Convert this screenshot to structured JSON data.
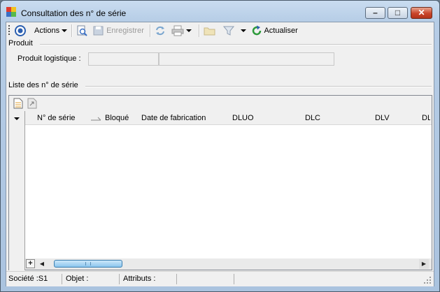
{
  "window": {
    "title": "Consultation des n° de série",
    "controls": {
      "minimize": "–",
      "maximize": "□",
      "close": "✕"
    }
  },
  "toolbar": {
    "actions_label": "Actions",
    "save_label": "Enregistrer",
    "refresh_label": "Actualiser"
  },
  "produit": {
    "section_title": "Produit",
    "label": "Produit logistique :",
    "code_value": "",
    "name_value": ""
  },
  "liste": {
    "section_title": "Liste des n° de série",
    "columns": [
      "N° de série",
      "Bloqué",
      "Date de fabrication",
      "DLUO",
      "DLC",
      "DLV",
      "DL"
    ],
    "rows": []
  },
  "statusbar": {
    "societe": "Société :S1",
    "objet": "Objet :",
    "attributs": "Attributs :"
  },
  "colors": {
    "accent_blue": "#3a6fc4",
    "refresh_green": "#2e9a3b",
    "close_red": "#c9452a"
  }
}
